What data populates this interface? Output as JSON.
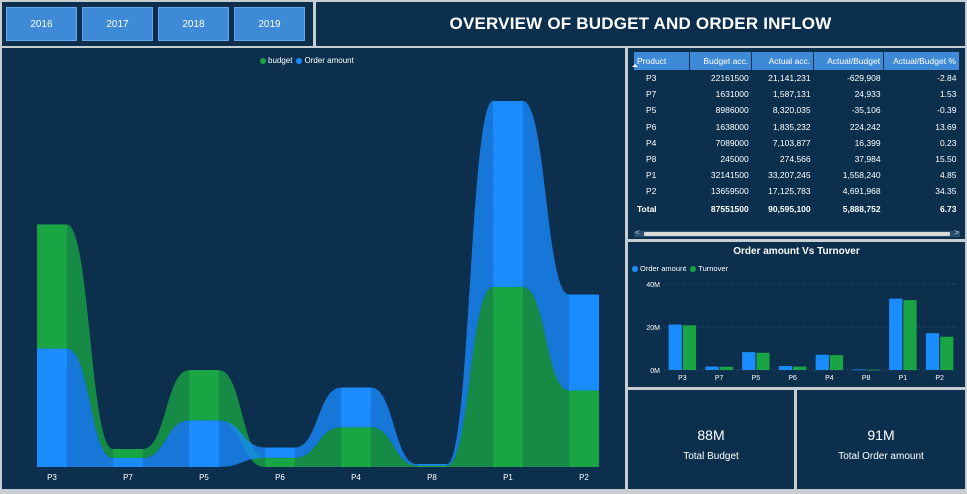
{
  "years": [
    "2016",
    "2017",
    "2018",
    "2019"
  ],
  "page_title": "OVERVIEW OF BUDGET AND ORDER INFLOW",
  "colors": {
    "background": "#0b2f4d",
    "budget": "#1aa544",
    "order": "#1a8cff",
    "turnover": "#1aa544",
    "header": "#3f8ad6"
  },
  "table": {
    "columns": [
      "Product",
      "Budget acc.",
      "Actual acc.",
      "Actual/Budget",
      "Actual/Budget %"
    ],
    "rows": [
      [
        "P3",
        "22161500",
        "21,141,231",
        "-629,908",
        "-2.84"
      ],
      [
        "P7",
        "1631000",
        "1,587,131",
        "24,933",
        "1.53"
      ],
      [
        "P5",
        "8986000",
        "8,320,035",
        "-35,106",
        "-0.39"
      ],
      [
        "P6",
        "1638000",
        "1,835,232",
        "224,242",
        "13.69"
      ],
      [
        "P4",
        "7089000",
        "7,103,877",
        "16,399",
        "0.23"
      ],
      [
        "P8",
        "245000",
        "274,566",
        "37,984",
        "15.50"
      ],
      [
        "P1",
        "32141500",
        "33,207,245",
        "1,558,240",
        "4.85"
      ],
      [
        "P2",
        "13659500",
        "17,125,783",
        "4,691,968",
        "34.35"
      ]
    ],
    "total": [
      "Total",
      "87551500",
      "90,595,100",
      "5,888,752",
      "6.73"
    ]
  },
  "cards": [
    {
      "value": "88M",
      "label": "Total Budget"
    },
    {
      "value": "91M",
      "label": "Total Order amount"
    }
  ],
  "chart_data": [
    {
      "type": "area",
      "title": "",
      "legend": [
        "budget",
        "Order amount"
      ],
      "legend_position": "top-center",
      "categories": [
        "P3",
        "P7",
        "P5",
        "P6",
        "P4",
        "P8",
        "P1",
        "P2"
      ],
      "series": [
        {
          "name": "budget",
          "values": [
            22161500,
            1631000,
            8986000,
            1638000,
            7089000,
            245000,
            32141500,
            13659500
          ]
        },
        {
          "name": "Order amount",
          "values": [
            21141231,
            1587131,
            8320035,
            1835232,
            7103877,
            274566,
            33207245,
            17125783
          ]
        }
      ],
      "stacked": true,
      "xlabel": "",
      "ylabel": ""
    },
    {
      "type": "bar",
      "title": "Order amount Vs Turnover",
      "legend": [
        "Order amount",
        "Turnover"
      ],
      "legend_position": "top-left",
      "categories": [
        "P3",
        "P7",
        "P5",
        "P6",
        "P4",
        "P8",
        "P1",
        "P2"
      ],
      "series": [
        {
          "name": "Order amount",
          "values": [
            21141231,
            1587131,
            8320035,
            1835232,
            7103877,
            274566,
            33207245,
            17125783
          ]
        },
        {
          "name": "Turnover",
          "values": [
            20800000,
            1500000,
            8000000,
            1600000,
            6900000,
            200000,
            32500000,
            15500000
          ]
        }
      ],
      "yticks": [
        "0M",
        "20M",
        "40M"
      ],
      "ylim": [
        0,
        40000000
      ],
      "grid": true
    }
  ]
}
